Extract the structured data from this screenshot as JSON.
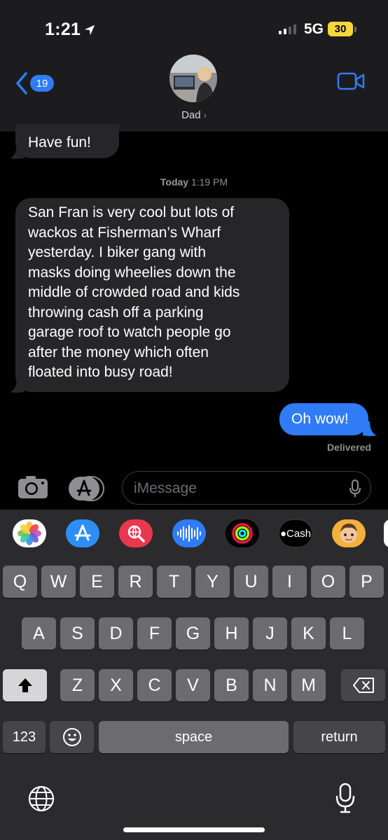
{
  "status_bar": {
    "time": "1:21",
    "network": "5G",
    "battery": "30"
  },
  "nav": {
    "back_count": "19",
    "contact_name": "Dad",
    "contact_chevron": "›"
  },
  "messages": {
    "previous_incoming": "Have fun!",
    "timestamp_day": "Today",
    "timestamp_time": "1:19 PM",
    "incoming_lines": [
      "San Fran is very cool but lots of",
      "wackos at Fisherman’s Wharf",
      "yesterday.  I biker gang with",
      "masks doing wheelies down the",
      "middle of crowded road and kids",
      "throwing cash off a parking",
      "garage roof to watch people go",
      "after the money which often",
      "floated into busy road!"
    ],
    "outgoing": "Oh wow!",
    "delivery_status": "Delivered"
  },
  "compose": {
    "placeholder": "iMessage"
  },
  "app_drawer": {
    "icons": [
      "photos-icon",
      "app-store-icon",
      "search-images-icon",
      "audio-message-icon",
      "activity-icon",
      "apple-cash-icon",
      "memoji-icon"
    ],
    "cash_label": "Cash"
  },
  "keyboard": {
    "row1": [
      "Q",
      "W",
      "E",
      "R",
      "T",
      "Y",
      "U",
      "I",
      "O",
      "P"
    ],
    "row2": [
      "A",
      "S",
      "D",
      "F",
      "G",
      "H",
      "J",
      "K",
      "L"
    ],
    "row3": [
      "Z",
      "X",
      "C",
      "V",
      "B",
      "N",
      "M"
    ],
    "numbers_label": "123",
    "space_label": "space",
    "return_label": "return"
  },
  "colors": {
    "accent_blue": "#2f7cf6",
    "incoming_bubble": "#262628",
    "battery_yellow": "#f5d73b",
    "header_bg": "#1c1c1e"
  }
}
